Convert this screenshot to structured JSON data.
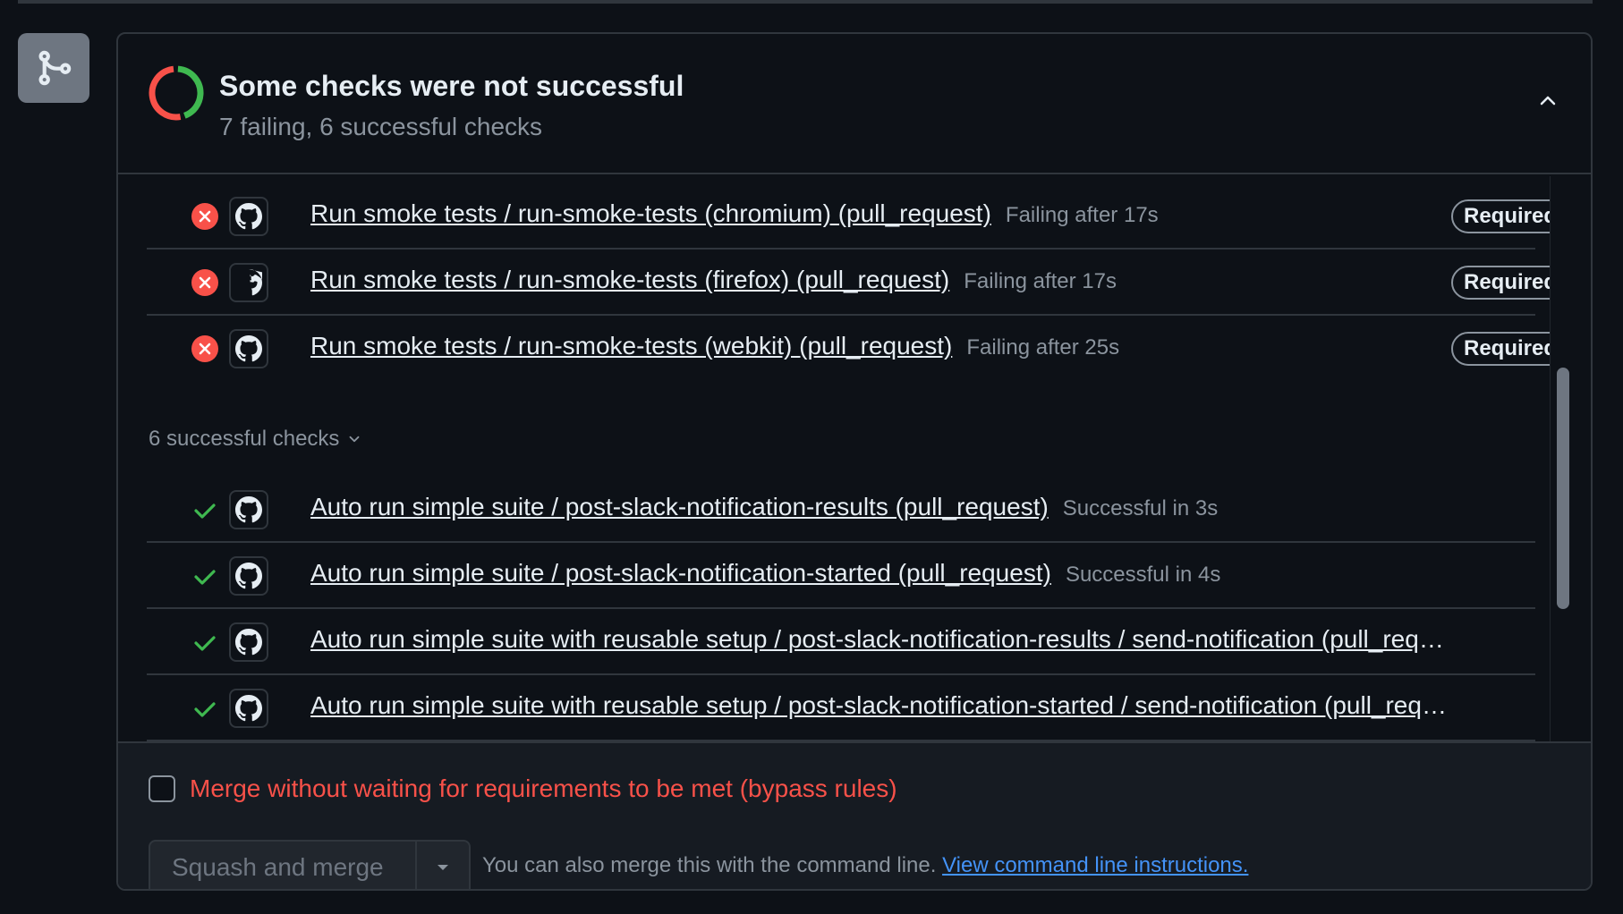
{
  "header": {
    "title": "Some checks were not successful",
    "subtitle": "7 failing, 6 successful checks",
    "failing_count": 7,
    "successful_count": 6,
    "failing_color": "#f85149",
    "success_color": "#3fb950"
  },
  "failing_checks": [
    {
      "name": "Run smoke tests / run-smoke-tests (chromium) (pull_request)",
      "status": "Failing after 17s",
      "badge": "Required"
    },
    {
      "name": "Run smoke tests / run-smoke-tests (firefox) (pull_request)",
      "status": "Failing after 17s",
      "badge": "Required"
    },
    {
      "name": "Run smoke tests / run-smoke-tests (webkit) (pull_request)",
      "status": "Failing after 25s",
      "badge": "Required"
    }
  ],
  "successful_section": {
    "label": "6 successful checks"
  },
  "successful_checks": [
    {
      "name": "Auto run simple suite / post-slack-notification-results (pull_request)",
      "status": "Successful in 3s"
    },
    {
      "name": "Auto run simple suite / post-slack-notification-started (pull_request)",
      "status": "Successful in 4s"
    },
    {
      "name": "Auto run simple suite with reusable setup / post-slack-notification-results / send-notification (pull_request)",
      "status": ""
    },
    {
      "name": "Auto run simple suite with reusable setup / post-slack-notification-started / send-notification (pull_request)",
      "status": ""
    }
  ],
  "footer": {
    "bypass_label": "Merge without waiting for requirements to be met (bypass rules)",
    "merge_button": "Squash and merge",
    "cli_text": "You can also merge this with the command line.",
    "cli_link": "View command line instructions."
  }
}
